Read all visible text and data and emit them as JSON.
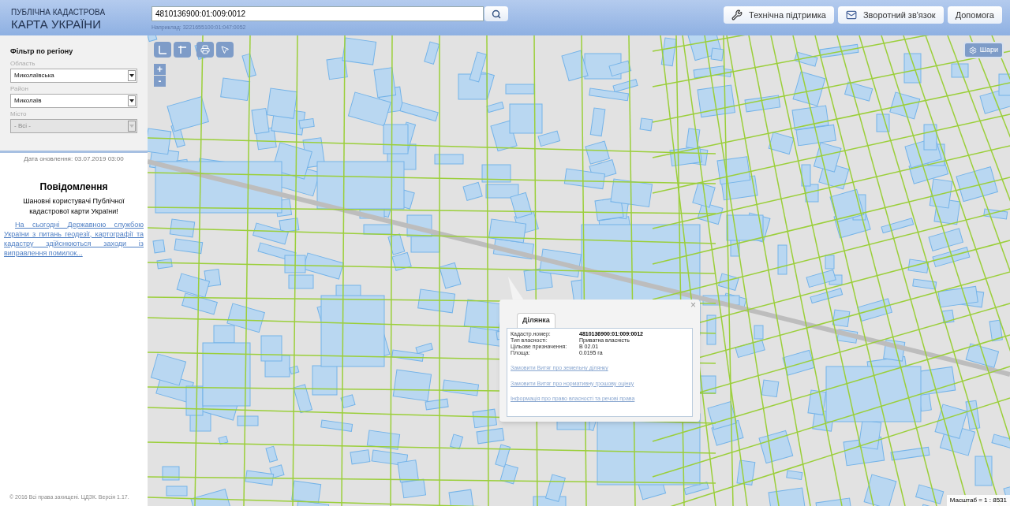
{
  "header": {
    "logo_top": "ПУБЛІЧНА КАДАСТРОВА",
    "logo_bottom": "КАРТА УКРАЇНИ",
    "search": {
      "value": "4810136900:01:009:0012",
      "hint": "Наприклад: 3221655100:01:047:0052"
    },
    "buttons": [
      {
        "kind": "tools",
        "label": "Технічна підтримка"
      },
      {
        "kind": "mail",
        "label": "Зворотний зв'язок"
      },
      {
        "kind": "plain",
        "label": "Допомога"
      }
    ]
  },
  "filter": {
    "title": "Фільтр по регіону",
    "fields": [
      {
        "label": "Область",
        "value": "Миколаївська",
        "disabled": false
      },
      {
        "label": "Район",
        "value": "Миколаїв",
        "disabled": false
      },
      {
        "label": "Місто",
        "value": "- Всі -",
        "disabled": true
      }
    ]
  },
  "update_date": "Дата оновлення: 03.07.2019 03:00",
  "notice": {
    "title": "Повідомлення",
    "greeting": "Шановні користувачі Публічної кадастрової карти України!",
    "link": "На сьогодні Державною службою України з питань геодезії, картографії та кадастру здійснюються заходи із виправлення помилок..."
  },
  "footer": "© 2016 Всі права захищені. ЦДЗК. Версія 1.17.",
  "map": {
    "zoom_in": "+",
    "zoom_out": "-",
    "layers_button": "Шари",
    "scale": "Масштаб = 1 : 8531",
    "popup": {
      "tab": "Ділянка",
      "close": "×",
      "rows": [
        {
          "label": "Кадастр.номер:",
          "value": "4810136900:01:009:0012",
          "bold": true
        },
        {
          "label": "Тип власності:",
          "value": "Приватна власність",
          "bold": false
        },
        {
          "label": "Цільове призначення:",
          "value": "В 02.01",
          "bold": false
        },
        {
          "label": "Площа:",
          "value": "0.0195 га",
          "bold": false
        }
      ],
      "links": [
        "Замовити Витяг про земельну ділянку",
        "Замовити Витяг про нормативну грошову оцінку",
        "Інформація про право власності та речові права"
      ]
    }
  }
}
